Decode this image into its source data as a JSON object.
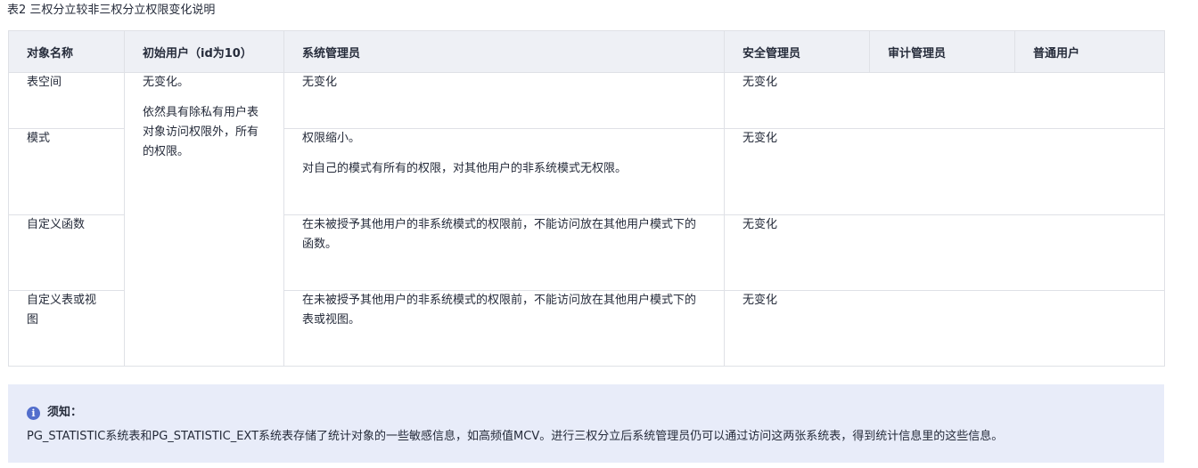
{
  "caption": "表2 三权分立较非三权分立权限变化说明",
  "table": {
    "headers": [
      "对象名称",
      "初始用户（id为10）",
      "系统管理员",
      "安全管理员",
      "审计管理员",
      "普通用户"
    ],
    "initial_user": [
      "无变化。",
      "依然具有除私有用户表对象访问权限外，所有的权限。"
    ],
    "rows": [
      {
        "object": "表空间",
        "sysadmin": [
          "无变化"
        ],
        "others": "无变化"
      },
      {
        "object": "模式",
        "sysadmin": [
          "权限缩小。",
          "对自己的模式有所有的权限，对其他用户的非系统模式无权限。"
        ],
        "others": "无变化"
      },
      {
        "object": "自定义函数",
        "sysadmin": [
          "在未被授予其他用户的非系统模式的权限前，不能访问放在其他用户模式下的函数。"
        ],
        "others": "无变化"
      },
      {
        "object": "自定义表或视图",
        "sysadmin": [
          "在未被授予其他用户的非系统模式的权限前，不能访问放在其他用户模式下的表或视图。"
        ],
        "others": "无变化"
      }
    ]
  },
  "notice": {
    "icon": "info-icon",
    "title": "须知：",
    "body": "PG_STATISTIC系统表和PG_STATISTIC_EXT系统表存储了统计对象的一些敏感信息，如高频值MCV。进行三权分立后系统管理员仍可以通过访问这两张系统表，得到统计信息里的这些信息。",
    "accent_color": "#526ecc",
    "background_color": "#e8ecf9"
  }
}
